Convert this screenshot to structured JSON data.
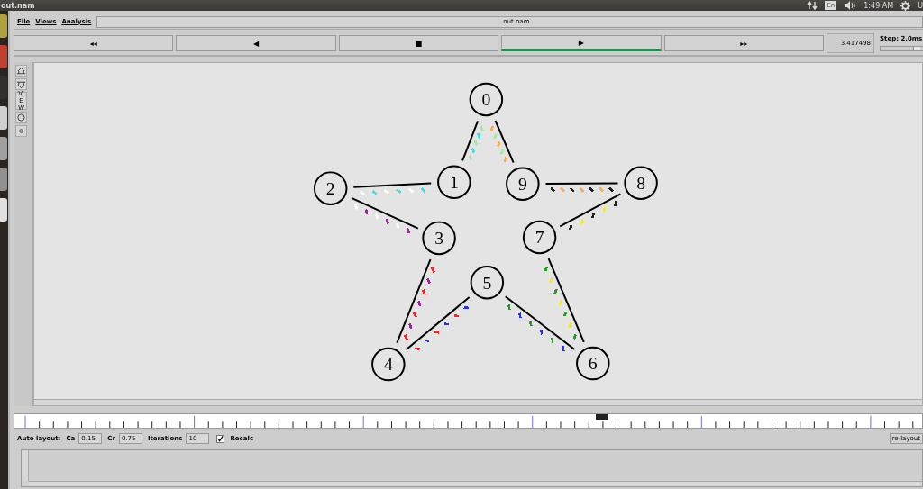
{
  "window": {
    "title": "out.nam"
  },
  "top_panel": {
    "keyboard": "En",
    "time": "1:49 AM",
    "user": "U"
  },
  "menu": [
    {
      "label": "File"
    },
    {
      "label": "Views"
    },
    {
      "label": "Analysis"
    }
  ],
  "file_field": {
    "value": "out.nam"
  },
  "controls": [
    {
      "label": "◂◂",
      "selected": false
    },
    {
      "label": "◀",
      "selected": false
    },
    {
      "label": "■",
      "selected": false
    },
    {
      "label": "▶",
      "selected": true
    },
    {
      "label": "▸▸",
      "selected": false
    }
  ],
  "time": "3.417498",
  "step": {
    "label": "Step: 2.0ms",
    "level": 0.8
  },
  "view_tools": [
    {
      "kind": "zoom-in"
    },
    {
      "kind": "zoom-out"
    },
    {
      "kind": "text",
      "label": "VIEW"
    },
    {
      "kind": "big-circle"
    },
    {
      "kind": "small-circle"
    }
  ],
  "nodes": [
    {
      "label": "0"
    },
    {
      "label": "2"
    },
    {
      "label": "1"
    },
    {
      "label": "9"
    },
    {
      "label": "8"
    },
    {
      "label": "3"
    },
    {
      "label": "7"
    },
    {
      "label": "5"
    },
    {
      "label": "4"
    },
    {
      "label": "6"
    }
  ],
  "links": [
    {
      "packets": [
        {
          "color": "#a8e6a8"
        },
        {
          "color": "#40e0e0"
        },
        {
          "color": "#a8e6a8"
        },
        {
          "color": "#40e0e0"
        },
        {
          "color": "#a8e6a8"
        }
      ]
    },
    {
      "packets": [
        {
          "color": "#f0b060"
        },
        {
          "color": "#a8e6a8"
        },
        {
          "color": "#f0b060"
        },
        {
          "color": "#a8e6a8"
        },
        {
          "color": "#f0b060"
        }
      ]
    },
    {
      "packets": [
        {
          "color": "#ffffff"
        },
        {
          "color": "#40e0e0"
        },
        {
          "color": "#ffffff"
        },
        {
          "color": "#40e0e0"
        },
        {
          "color": "#ffffff"
        },
        {
          "color": "#40e0e0"
        }
      ]
    },
    {
      "packets": [
        {
          "color": "#ffffff"
        },
        {
          "color": "#a020a0"
        },
        {
          "color": "#ffffff"
        },
        {
          "color": "#a020a0"
        },
        {
          "color": "#ffffff"
        },
        {
          "color": "#a020a0"
        }
      ]
    },
    {
      "packets": [
        {
          "color": "#ff2020"
        },
        {
          "color": "#a020a0"
        },
        {
          "color": "#ff2020"
        },
        {
          "color": "#a020a0"
        },
        {
          "color": "#ff2020"
        },
        {
          "color": "#a020a0"
        },
        {
          "color": "#ff2020"
        }
      ]
    },
    {
      "packets": [
        {
          "color": "#ff2020"
        },
        {
          "color": "#2030ff"
        },
        {
          "color": "#ff2020"
        },
        {
          "color": "#2030ff"
        },
        {
          "color": "#ff2020"
        },
        {
          "color": "#2030ff"
        }
      ]
    },
    {
      "packets": [
        {
          "color": "#20a020"
        },
        {
          "color": "#2030ff"
        },
        {
          "color": "#20a020"
        },
        {
          "color": "#2030ff"
        },
        {
          "color": "#20a020"
        },
        {
          "color": "#2030ff"
        }
      ]
    },
    {
      "packets": [
        {
          "color": "#20a020"
        },
        {
          "color": "#f0f020"
        },
        {
          "color": "#20a020"
        },
        {
          "color": "#f0f020"
        },
        {
          "color": "#20a020"
        },
        {
          "color": "#f0f020"
        },
        {
          "color": "#20a020"
        }
      ]
    },
    {
      "packets": [
        {
          "color": "#202020"
        },
        {
          "color": "#f0f020"
        },
        {
          "color": "#202020"
        },
        {
          "color": "#f0f020"
        },
        {
          "color": "#202020"
        }
      ]
    },
    {
      "packets": [
        {
          "color": "#202020"
        },
        {
          "color": "#f0b060"
        },
        {
          "color": "#202020"
        },
        {
          "color": "#f0b060"
        },
        {
          "color": "#202020"
        },
        {
          "color": "#f0b060"
        },
        {
          "color": "#202020"
        }
      ]
    }
  ],
  "auto_layout": {
    "label": "Auto layout:",
    "fields": [
      {
        "label": "Ca",
        "value": "0.15"
      },
      {
        "label": "Cr",
        "value": "0.75"
      },
      {
        "label": "Iterations",
        "value": "10"
      }
    ],
    "recalc": {
      "label": "Recalc",
      "checked": true
    },
    "button": "re-layout"
  }
}
